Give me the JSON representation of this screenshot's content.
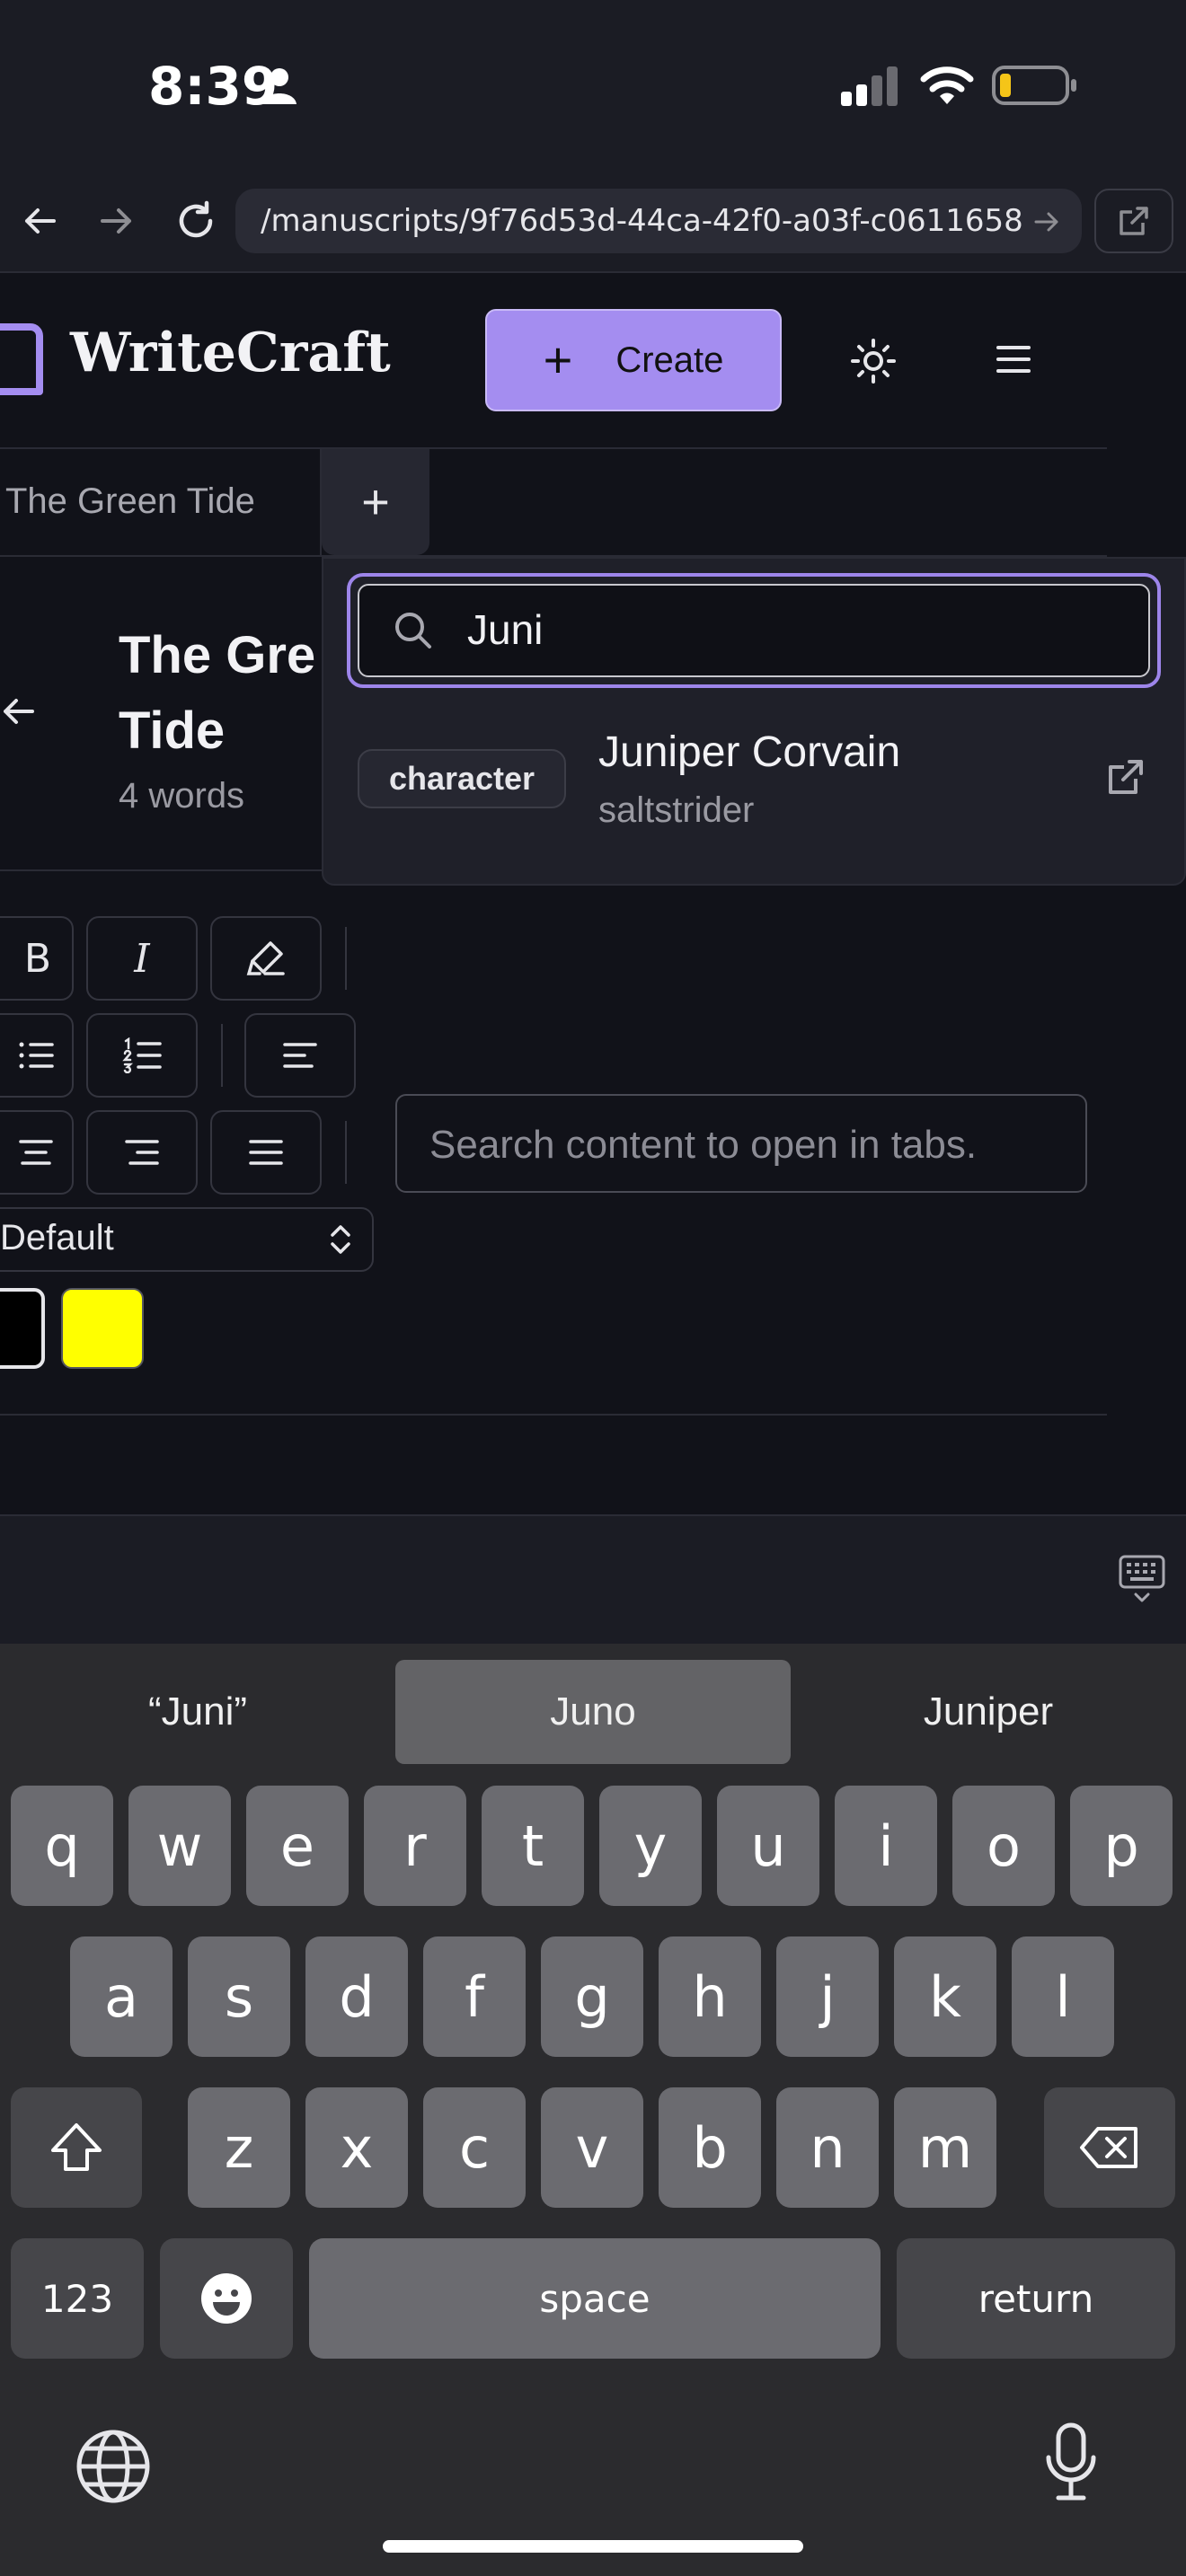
{
  "status": {
    "time": "8:39"
  },
  "browser": {
    "url": "/manuscripts/9f76d53d-44ca-42f0-a03f-c0611658"
  },
  "header": {
    "app_name": "WriteCraft",
    "create_label": "Create"
  },
  "tabs": {
    "items": [
      {
        "label": "The Green Tide"
      }
    ],
    "add_label": "+"
  },
  "document": {
    "title": "The Green Tide",
    "title_visible": "The Gre Tide",
    "word_count": "4 words"
  },
  "toolbar": {
    "bold": "B",
    "italic": "I",
    "font_select_value": "Default",
    "text_colors": [
      "#000000",
      "#ffff00"
    ]
  },
  "tab_search": {
    "placeholder": "Search content to open in tabs."
  },
  "search": {
    "value": "Juni",
    "results": [
      {
        "badge": "character",
        "name": "Juniper Corvain",
        "subtitle": "saltstrider"
      }
    ]
  },
  "keyboard": {
    "suggestions": [
      "“Juni”",
      "Juno",
      "Juniper"
    ],
    "row1": [
      "q",
      "w",
      "e",
      "r",
      "t",
      "y",
      "u",
      "i",
      "o",
      "p"
    ],
    "row2": [
      "a",
      "s",
      "d",
      "f",
      "g",
      "h",
      "j",
      "k",
      "l"
    ],
    "row3": [
      "z",
      "x",
      "c",
      "v",
      "b",
      "n",
      "m"
    ],
    "numbers_label": "123",
    "space_label": "space",
    "return_label": "return"
  },
  "colors": {
    "accent": "#a48df0",
    "background": "#111219",
    "keyboard": "#2b2b2e"
  }
}
